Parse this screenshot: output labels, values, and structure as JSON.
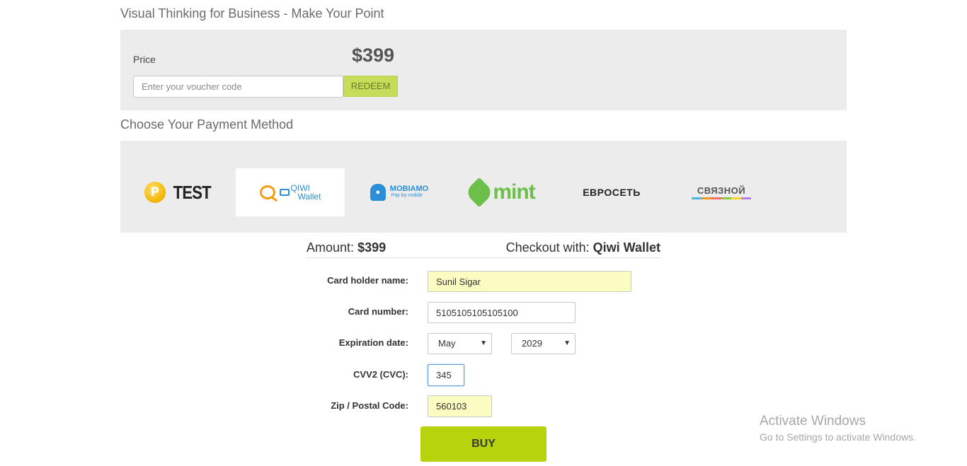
{
  "course": {
    "title": "Visual Thinking for Business - Make Your Point"
  },
  "price": {
    "label": "Price",
    "value": "$399",
    "voucher_placeholder": "Enter your voucher code",
    "redeem_label": "REDEEM"
  },
  "payment": {
    "heading": "Choose Your Payment Method",
    "methods": [
      {
        "name": "TEST",
        "coin_glyph": "P",
        "selected": false
      },
      {
        "name": "QIWI Wallet",
        "line1": "QIWI",
        "line2": "Wallet",
        "selected": true
      },
      {
        "name": "MOBIAMO",
        "line1": "MOBIAMO",
        "line2": "Pay by mobile",
        "selected": false
      },
      {
        "name": "mint",
        "text": "mint",
        "selected": false
      },
      {
        "name": "ЕВРОСЕТЬ",
        "text": "ЕВРОСЕТЬ",
        "selected": false
      },
      {
        "name": "СВЯЗНОЙ",
        "text": "СВЯЗНОЙ",
        "selected": false
      }
    ]
  },
  "summary": {
    "amount_label": "Amount:",
    "amount_value": "$399",
    "checkout_label": "Checkout with:",
    "checkout_value": "Qiwi Wallet"
  },
  "form": {
    "card_holder_label": "Card holder name:",
    "card_holder_value": "Sunil Sigar",
    "card_number_label": "Card number:",
    "card_number_value": "5105105105105100",
    "expiration_label": "Expiration date:",
    "expiration_month": "May",
    "expiration_year": "2029",
    "cvv_label": "CVV2 (CVC):",
    "cvv_value": "345",
    "zip_label": "Zip / Postal Code:",
    "zip_value": "560103",
    "buy_label": "BUY"
  },
  "watermark": {
    "line1": "Activate Windows",
    "line2": "Go to Settings to activate Windows."
  },
  "colors": {
    "redeem": "#c5dd5a",
    "buy": "#b5d40b",
    "panel": "#ececec",
    "autofill": "#fafcc2",
    "qiwi_orange": "#f39c12",
    "qiwi_blue": "#2a8fd8",
    "mint_green": "#6cc04a"
  }
}
